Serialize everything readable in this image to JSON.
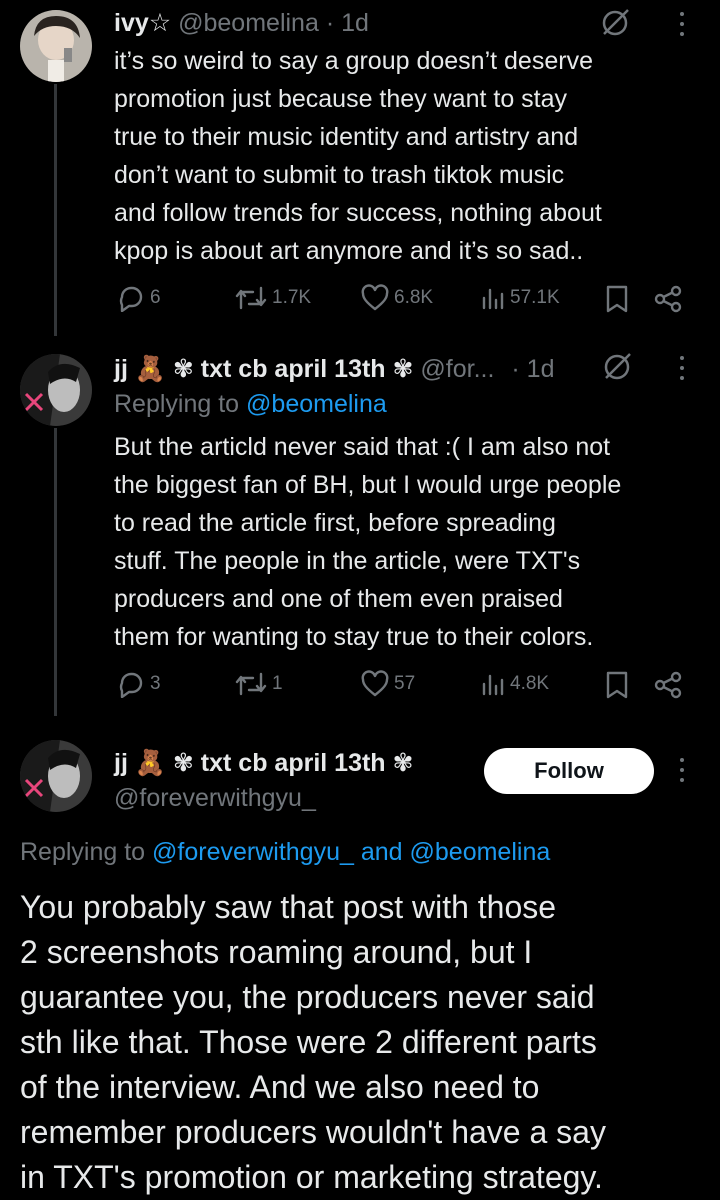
{
  "tweet1": {
    "display_name": "ivy☆",
    "handle": "@beomelina",
    "time": "· 1d",
    "lines": [
      "it’s so weird to say a group doesn’t deserve",
      "promotion just because they want to stay",
      "true to their music identity and artistry and",
      "don’t want to submit to trash tiktok music",
      "and follow trends for success, nothing about",
      "kpop is about art anymore and it’s so sad.."
    ],
    "replies": "6",
    "reposts": "1.7K",
    "likes": "6.8K",
    "views": "57.1K"
  },
  "tweet2": {
    "display_name": "jj 🧸 ✾ txt cb april 13th ✾",
    "handle": "@for...",
    "time": "· 1d",
    "replying_prefix": "Replying to",
    "replying_handle": "@beomelina",
    "lines": [
      "But the articld never said that :( I am also not",
      "the biggest fan of BH, but I would urge people",
      "to read the article first, before spreading",
      "stuff. The people in the article, were TXT's",
      "producers and one of them even praised",
      "them for wanting to stay true to their colors."
    ],
    "replies": "3",
    "reposts": "1",
    "likes": "57",
    "views": "4.8K"
  },
  "main_tweet": {
    "display_name": "jj 🧸 ✾ txt cb april 13th ✾",
    "handle": "@foreverwithgyu_",
    "follow_label": "Follow",
    "replying_prefix": "Replying to",
    "replying_handle_1": "@foreverwithgyu_",
    "replying_and": "and",
    "replying_handle_2": "@beomelina",
    "lines": [
      "You probably saw that post with those",
      "2 screenshots roaming around, but I",
      "guarantee you, the producers never said",
      "sth like that. Those were 2 different parts",
      "of the interview. And we also need to",
      "remember producers wouldn't have a say",
      "in TXT's promotion or marketing strategy."
    ]
  },
  "colors": {
    "background": "#000000",
    "text": "#e7e9ea",
    "muted": "#71767b",
    "link": "#1d9bf0",
    "divider": "#333639"
  }
}
